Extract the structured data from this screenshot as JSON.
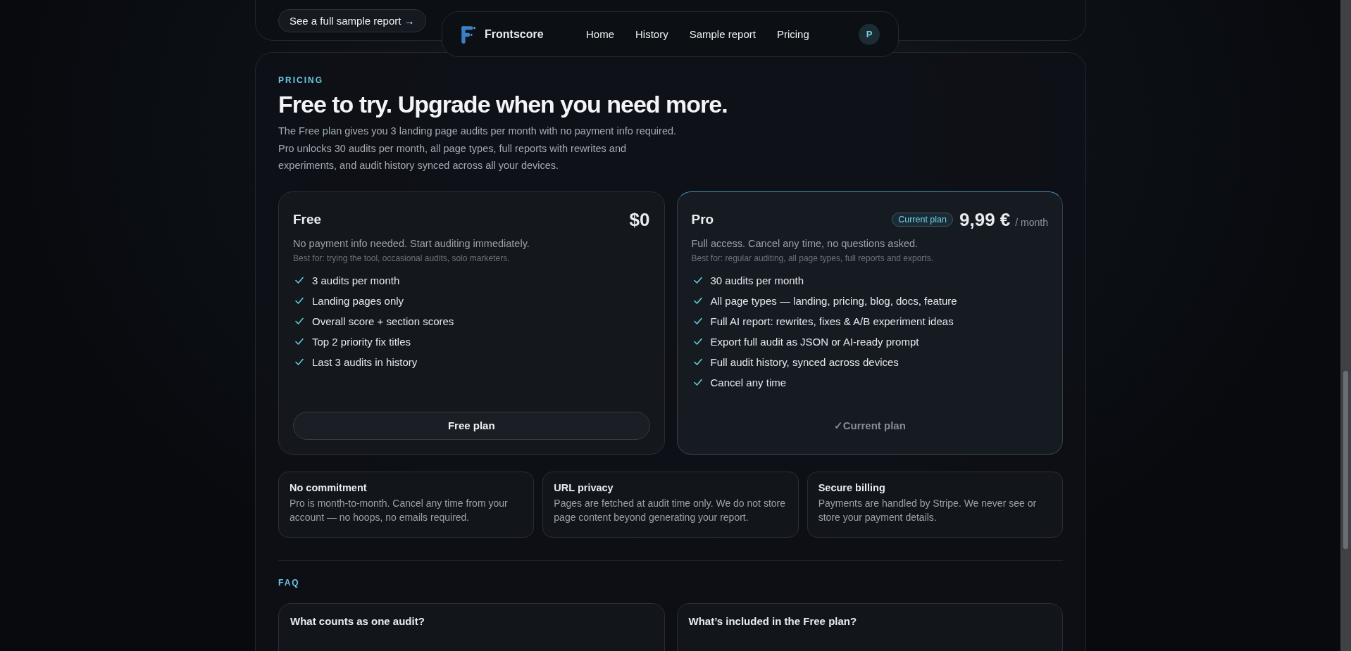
{
  "top_link": "See a full sample report →",
  "nav": {
    "brand": "Frontscore",
    "links": [
      "Home",
      "History",
      "Sample report",
      "Pricing"
    ],
    "avatar": "P"
  },
  "pricing": {
    "eyebrow": "PRICING",
    "title": "Free to try. Upgrade when you need more.",
    "intro": [
      "The Free plan gives you 3 landing page audits per month with no payment info required.",
      "Pro unlocks 30 audits per month, all page types, full reports with rewrites and",
      "experiments, and audit history synced across all your devices."
    ],
    "plans": [
      {
        "name": "Free",
        "price": "$0",
        "current": false,
        "description": "No payment info needed. Start auditing immediately.",
        "best_for": "Best for: trying the tool, occasional audits, solo marketers.",
        "features": [
          "3 audits per month",
          "Landing pages only",
          "Overall score + section scores",
          "Top 2 priority fix titles",
          "Last 3 audits in history"
        ],
        "button": "Free plan"
      },
      {
        "name": "Pro",
        "badge": "Current plan",
        "price": "9,99 €",
        "period": "/ month",
        "current": true,
        "description": "Full access. Cancel any time, no questions asked.",
        "best_for": "Best for: regular auditing, all page types, full reports and exports.",
        "features": [
          "30 audits per month",
          "All page types — landing, pricing, blog, docs, feature",
          "Full AI report: rewrites, fixes & A/B experiment ideas",
          "Export full audit as JSON or AI-ready prompt",
          "Full audit history, synced across devices",
          "Cancel any time"
        ],
        "button": "✓Current plan"
      }
    ],
    "assurances": [
      {
        "title": "No commitment",
        "text": "Pro is month-to-month. Cancel any time from your account — no hoops, no emails required."
      },
      {
        "title": "URL privacy",
        "text": "Pages are fetched at audit time only. We do not store page content beyond generating your report."
      },
      {
        "title": "Secure billing",
        "text": "Payments are handled by Stripe. We never see or store your payment details."
      }
    ]
  },
  "faq": {
    "eyebrow": "FAQ",
    "questions": [
      "What counts as one audit?",
      "What’s included in the Free plan?"
    ]
  }
}
